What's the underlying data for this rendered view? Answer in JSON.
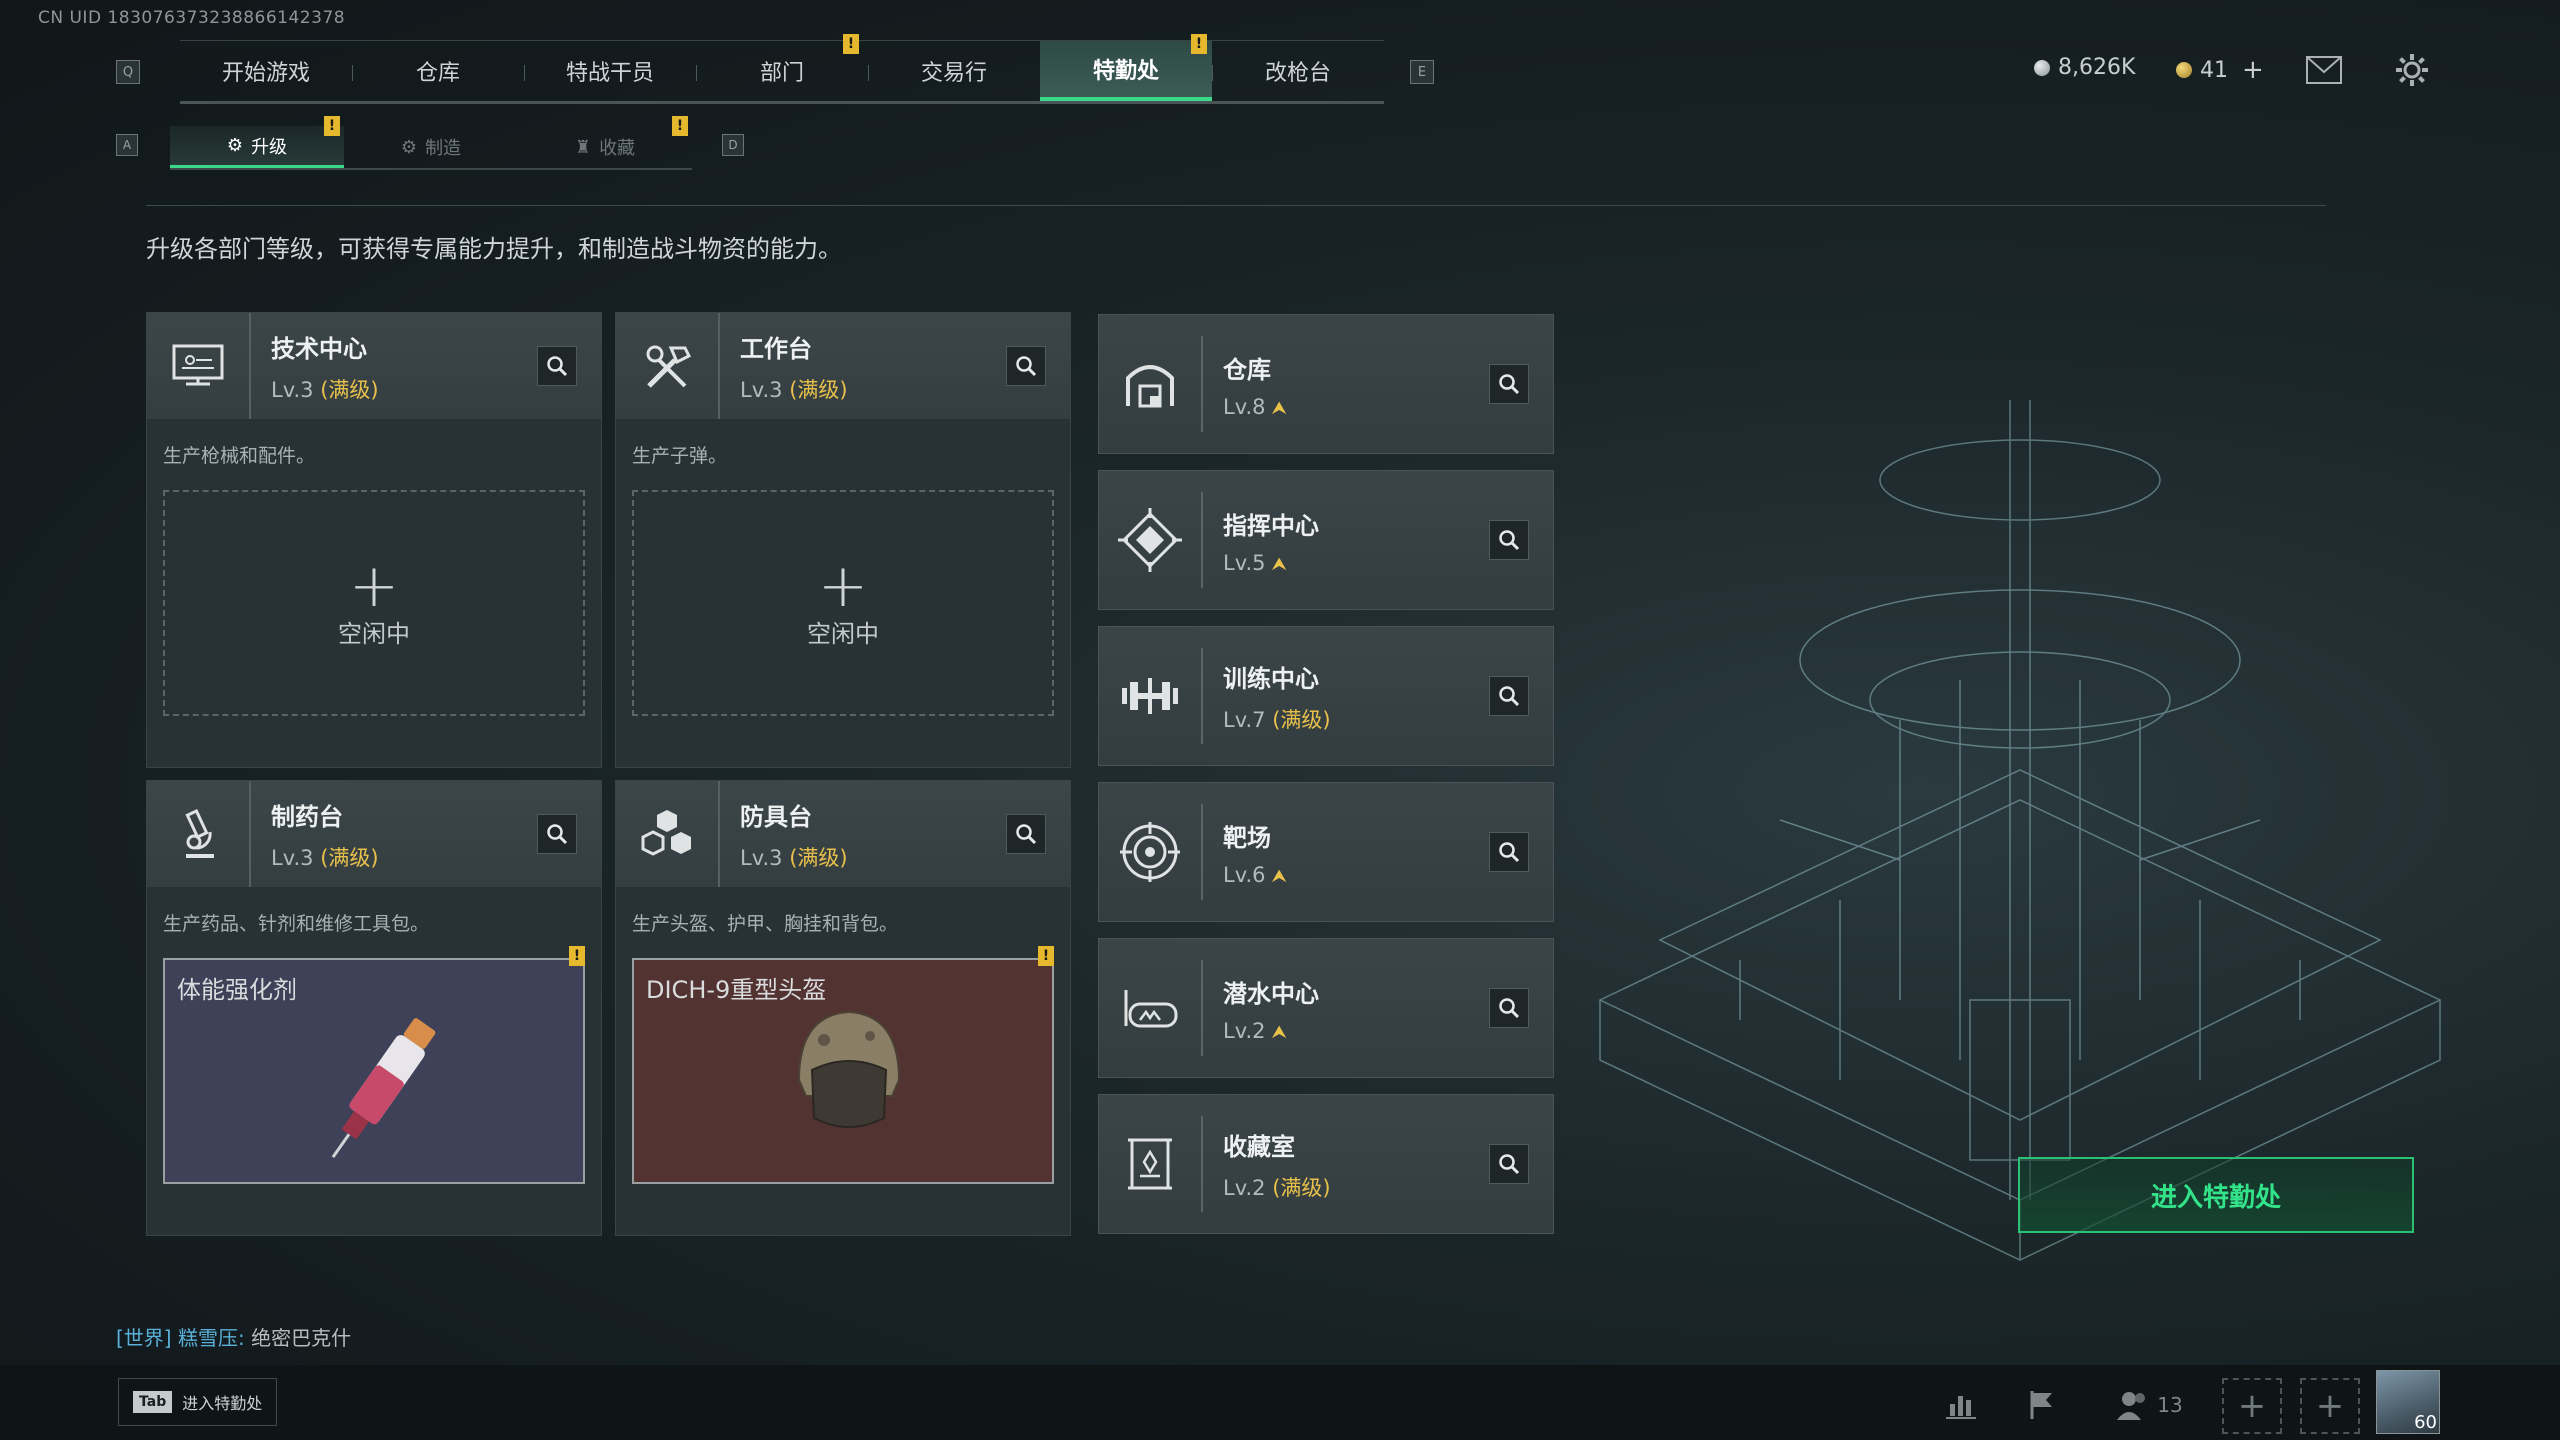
{
  "uid": "CN UID 183076373238866142378",
  "nav": {
    "left_key": "Q",
    "right_key": "E",
    "tabs": [
      {
        "label": "开始游戏"
      },
      {
        "label": "仓库"
      },
      {
        "label": "特战干员"
      },
      {
        "label": "部门"
      },
      {
        "label": "交易行"
      },
      {
        "label": "特勤处"
      },
      {
        "label": "改枪台"
      }
    ],
    "active_tab": "特勤处"
  },
  "currency": {
    "silver": "8,626K",
    "gold": "41",
    "add": "+",
    "silver_color": "#b9bfc2",
    "gold_color": "#d8b24a"
  },
  "subtabs": {
    "left_key": "A",
    "right_key": "D",
    "items": [
      {
        "label": "升级"
      },
      {
        "label": "制造"
      },
      {
        "label": "收藏"
      }
    ]
  },
  "warning_glyph": "!",
  "description": "升级各部门等级，可获得专属能力提升，和制造战斗物资的能力。",
  "stations": [
    {
      "name": "技术中心",
      "level": "Lv.3",
      "max": "(满级)",
      "desc": "生产枪械和配件。",
      "slot_label": "空闲中",
      "plus": "+",
      "icon": "computer-icon"
    },
    {
      "name": "工作台",
      "level": "Lv.3",
      "max": "(满级)",
      "desc": "生产子弹。",
      "slot_label": "空闲中",
      "plus": "+",
      "icon": "tools-icon"
    },
    {
      "name": "制药台",
      "level": "Lv.3",
      "max": "(满级)",
      "desc": "生产药品、针剂和维修工具包。",
      "product": "体能强化剂",
      "icon": "microscope-icon"
    },
    {
      "name": "防具台",
      "level": "Lv.3",
      "max": "(满级)",
      "desc": "生产头盔、护甲、胸挂和背包。",
      "product": "DICH-9重型头盔",
      "icon": "armor-icon"
    }
  ],
  "departments": [
    {
      "name": "仓库",
      "level": "Lv.8",
      "max": "",
      "upgradable": true,
      "icon": "warehouse-icon"
    },
    {
      "name": "指挥中心",
      "level": "Lv.5",
      "max": "",
      "upgradable": true,
      "icon": "command-icon"
    },
    {
      "name": "训练中心",
      "level": "Lv.7",
      "max": "(满级)",
      "upgradable": false,
      "icon": "dumbbell-icon"
    },
    {
      "name": "靶场",
      "level": "Lv.6",
      "max": "",
      "upgradable": true,
      "icon": "target-icon"
    },
    {
      "name": "潜水中心",
      "level": "Lv.2",
      "max": "",
      "upgradable": true,
      "icon": "goggles-icon"
    },
    {
      "name": "收藏室",
      "level": "Lv.2",
      "max": "(满级)",
      "upgradable": false,
      "icon": "collection-icon"
    }
  ],
  "upgrade_glyph": "⮝",
  "enter_button": "进入特勤处",
  "chat": {
    "channel": "[世界]",
    "user": "糕雪压:",
    "message": "绝密巴克什"
  },
  "tab_hint": {
    "key": "Tab",
    "label": "进入特勤处"
  },
  "friends_count": "13",
  "player_level": "60",
  "colors": {
    "accent_green": "#3bd889",
    "max_level_gold": "#e8c04a",
    "warning_yellow": "#e6b82d"
  }
}
